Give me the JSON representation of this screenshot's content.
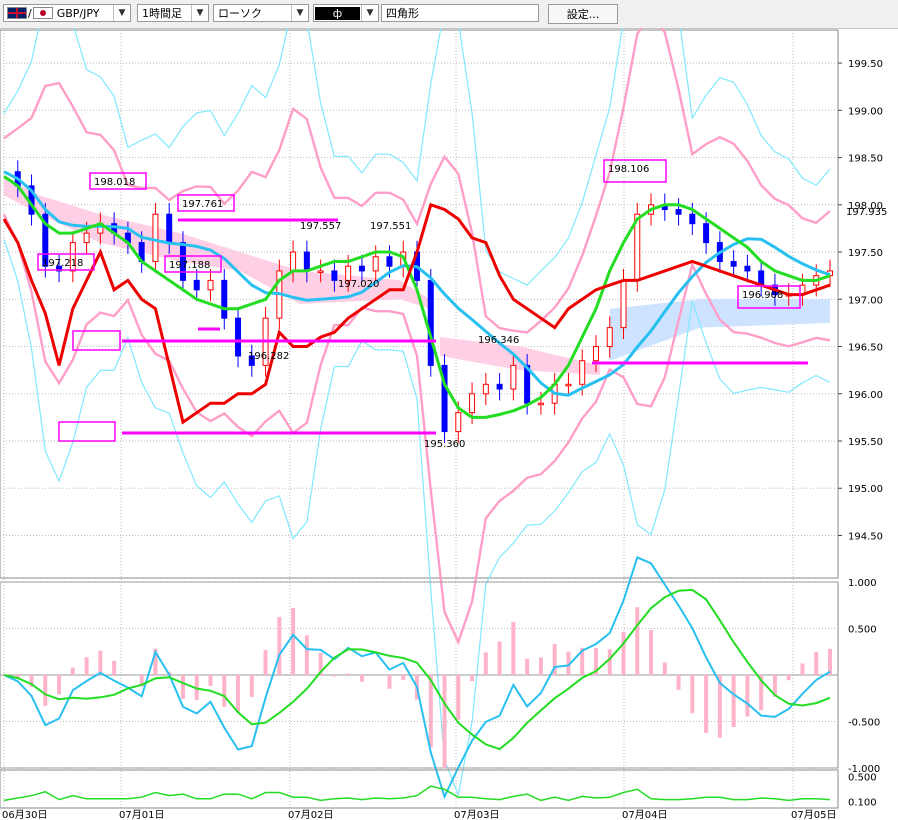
{
  "toolbar": {
    "symbol_separator": "/",
    "symbol": "GBP/JPY",
    "timeframe": "1時間足",
    "chart_style": "ローソク",
    "drawing_tool": "ф",
    "shape": "四角形",
    "settings_label": "設定..."
  },
  "colors": {
    "up_candle": "#ff0000",
    "down_candle": "#0000ff",
    "kumo_up": "#ffc8e0",
    "kumo_down": "#c8e0ff",
    "bb_outer": "#80e8ff",
    "bb_inner": "#ff9ec8",
    "ma_green": "#22dd22",
    "ma_blue": "#28c0f0",
    "red_line": "#ee0000",
    "magenta": "#ff00ff"
  },
  "chart_data": [
    {
      "type": "line",
      "pane": "price",
      "symbol": "GBP/JPY",
      "timeframe": "1時間足",
      "y_ticks": [
        "199.50",
        "199.00",
        "198.50",
        "198.00",
        "197.50",
        "197.00",
        "196.50",
        "196.00",
        "195.50",
        "195.00",
        "194.50"
      ],
      "ylim": [
        194.05,
        199.85
      ],
      "x_ticks": [
        "06月30日",
        "07月01日",
        "07月02日",
        "07月03日",
        "07月04日",
        "07月05日"
      ],
      "current_price": "197.935",
      "x": [
        0,
        2,
        4,
        6,
        8,
        10,
        12,
        14,
        16,
        18,
        20,
        22,
        24,
        26,
        28,
        30,
        32,
        34,
        36,
        38,
        40,
        42,
        44,
        46,
        48,
        50,
        52,
        54,
        56,
        58,
        60,
        62,
        64,
        66,
        68,
        70,
        72,
        74,
        76,
        78,
        80,
        82,
        84,
        86,
        88,
        90,
        92,
        94,
        96,
        98,
        100,
        102,
        104,
        106,
        108,
        110,
        112,
        114,
        116,
        118,
        120
      ],
      "series": [
        {
          "role": "close_candles",
          "values": [
            198.35,
            198.2,
            197.9,
            197.35,
            197.3,
            197.6,
            197.7,
            197.8,
            197.7,
            197.6,
            197.4,
            197.9,
            197.6,
            197.2,
            197.1,
            197.2,
            196.8,
            196.4,
            196.3,
            196.8,
            197.3,
            197.5,
            197.3,
            197.3,
            197.2,
            197.35,
            197.3,
            197.45,
            197.35,
            197.5,
            197.2,
            196.3,
            195.6,
            195.8,
            196.0,
            196.1,
            196.05,
            196.3,
            195.9,
            195.9,
            196.1,
            196.1,
            196.35,
            196.5,
            196.7,
            197.2,
            197.9,
            198.0,
            197.95,
            197.9,
            197.8,
            197.6,
            197.4,
            197.35,
            197.3,
            197.15,
            197.05,
            197.05,
            197.15,
            197.25,
            197.3
          ]
        },
        {
          "role": "moving_average_green",
          "values": [
            198.3,
            198.2,
            198.0,
            197.8,
            197.7,
            197.7,
            197.75,
            197.8,
            197.7,
            197.6,
            197.4,
            197.3,
            197.2,
            197.1,
            197.0,
            196.95,
            196.9,
            196.9,
            196.95,
            197.0,
            197.2,
            197.3,
            197.3,
            197.35,
            197.4,
            197.4,
            197.45,
            197.5,
            197.5,
            197.45,
            197.1,
            196.6,
            196.1,
            195.85,
            195.75,
            195.75,
            195.78,
            195.82,
            195.88,
            195.96,
            196.1,
            196.3,
            196.6,
            196.9,
            197.3,
            197.6,
            197.85,
            197.95,
            198.0,
            198.0,
            197.95,
            197.85,
            197.75,
            197.65,
            197.55,
            197.4,
            197.3,
            197.25,
            197.2,
            197.2,
            197.25
          ]
        },
        {
          "role": "red_line",
          "values": [
            197.85,
            197.6,
            197.2,
            196.85,
            196.3,
            196.9,
            197.2,
            197.5,
            197.1,
            197.2,
            197.0,
            196.9,
            196.3,
            195.7,
            195.8,
            195.9,
            195.9,
            196.0,
            196.0,
            196.1,
            196.65,
            196.5,
            196.5,
            196.6,
            196.65,
            196.8,
            196.9,
            197.0,
            197.1,
            197.1,
            197.5,
            198.0,
            197.95,
            197.85,
            197.65,
            197.6,
            197.25,
            197.0,
            196.9,
            196.8,
            196.7,
            196.9,
            197.0,
            197.1,
            197.15,
            197.2,
            197.2,
            197.25,
            197.3,
            197.35,
            197.4,
            197.35,
            197.3,
            197.25,
            197.2,
            197.15,
            197.1,
            197.05,
            197.05,
            197.1,
            197.15
          ]
        }
      ]
    },
    {
      "type": "line",
      "pane": "macd",
      "y_ticks": [
        "1.000",
        "0.500",
        "-0.500",
        "-1.000"
      ],
      "ylim": [
        -1.0,
        1.0
      ]
    },
    {
      "type": "line",
      "pane": "oscillator",
      "y_ticks": [
        "0.500",
        "0.100"
      ],
      "ylim": [
        0.0,
        0.6
      ]
    }
  ],
  "annotations": {
    "price_labels": [
      "198.018",
      "197.761",
      "197.218",
      "197.188",
      "197.557",
      "197.551",
      "197.020",
      "196.282",
      "196.346",
      "195.360",
      "198.106",
      "196.908"
    ]
  }
}
